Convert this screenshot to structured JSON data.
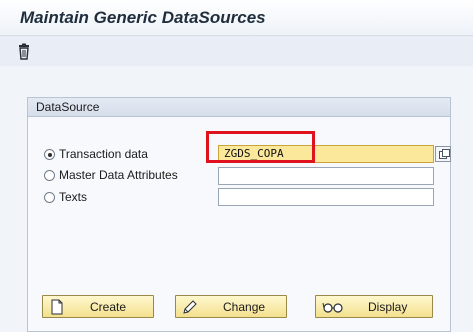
{
  "header": {
    "title": "Maintain Generic DataSources"
  },
  "toolbar": {
    "delete_icon": "trash-icon"
  },
  "group": {
    "title": "DataSource",
    "options": [
      {
        "label": "Transaction data",
        "selected": true,
        "value": "ZGDS_COPA"
      },
      {
        "label": "Master Data Attributes",
        "selected": false,
        "value": ""
      },
      {
        "label": "Texts",
        "selected": false,
        "value": ""
      }
    ]
  },
  "buttons": {
    "create": {
      "label": "Create",
      "icon": "new-document-icon"
    },
    "change": {
      "label": "Change",
      "icon": "pencil-icon"
    },
    "display": {
      "label": "Display",
      "icon": "glasses-icon"
    }
  },
  "colors": {
    "accent_field": "#fbe89a",
    "highlight": "#e0121e",
    "button": "#f3e08d"
  }
}
